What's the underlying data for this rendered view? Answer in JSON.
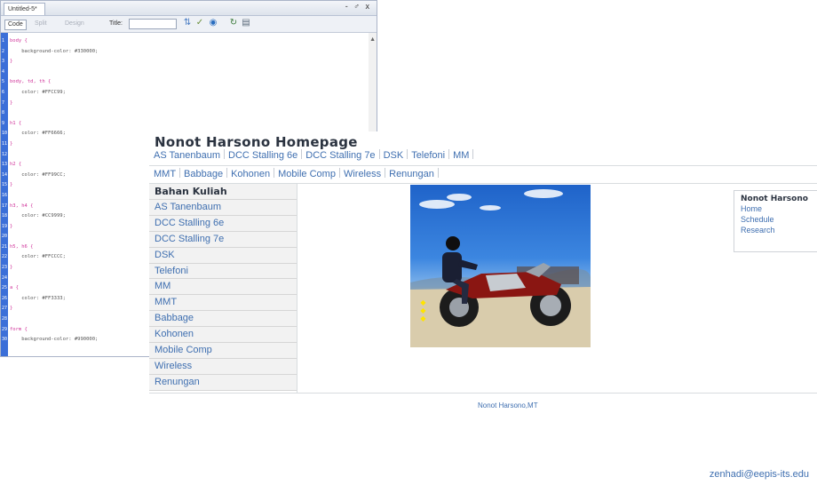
{
  "editor": {
    "tab_title": "Untitled-5*",
    "window_buttons": "- ♂ x",
    "toolbar": {
      "code_label": "Code",
      "split_label": "Split",
      "design_label": "Design",
      "title_label": "Title:"
    },
    "code_lines": [
      {
        "n": "1",
        "text": "body {",
        "cls": "sel"
      },
      {
        "n": "2",
        "text": "    background-color: #330000;",
        "cls": "prop"
      },
      {
        "n": "3",
        "text": "}",
        "cls": "brace"
      },
      {
        "n": "4",
        "text": "",
        "cls": "prop"
      },
      {
        "n": "5",
        "text": "body, td, th {",
        "cls": "sel"
      },
      {
        "n": "6",
        "text": "    color: #FFCC99;",
        "cls": "prop"
      },
      {
        "n": "7",
        "text": "}",
        "cls": "brace"
      },
      {
        "n": "8",
        "text": "",
        "cls": "prop"
      },
      {
        "n": "9",
        "text": "h1 {",
        "cls": "sel"
      },
      {
        "n": "10",
        "text": "    color: #FF6666;",
        "cls": "prop"
      },
      {
        "n": "11",
        "text": "}",
        "cls": "brace"
      },
      {
        "n": "12",
        "text": "",
        "cls": "prop"
      },
      {
        "n": "13",
        "text": "h2 {",
        "cls": "sel"
      },
      {
        "n": "14",
        "text": "    color: #FF99CC;",
        "cls": "prop"
      },
      {
        "n": "15",
        "text": "}",
        "cls": "brace"
      },
      {
        "n": "16",
        "text": "",
        "cls": "prop"
      },
      {
        "n": "17",
        "text": "h3, h4 {",
        "cls": "sel"
      },
      {
        "n": "18",
        "text": "    color: #CC9999;",
        "cls": "prop"
      },
      {
        "n": "19",
        "text": "}",
        "cls": "brace"
      },
      {
        "n": "20",
        "text": "",
        "cls": "prop"
      },
      {
        "n": "21",
        "text": "h5, h6 {",
        "cls": "sel"
      },
      {
        "n": "22",
        "text": "    color: #FFCCCC;",
        "cls": "prop"
      },
      {
        "n": "23",
        "text": "}",
        "cls": "brace"
      },
      {
        "n": "24",
        "text": "",
        "cls": "prop"
      },
      {
        "n": "25",
        "text": "a {",
        "cls": "sel"
      },
      {
        "n": "26",
        "text": "    color: #FF3333;",
        "cls": "prop"
      },
      {
        "n": "27",
        "text": "}",
        "cls": "brace"
      },
      {
        "n": "28",
        "text": "",
        "cls": "prop"
      },
      {
        "n": "29",
        "text": "form {",
        "cls": "sel"
      },
      {
        "n": "30",
        "text": "    background-color: #990000;",
        "cls": "prop"
      }
    ]
  },
  "site": {
    "title": "Nonot Harsono Homepage",
    "nav_row1": [
      "AS Tanenbaum",
      "DCC Stalling 6e",
      "DCC Stalling 7e",
      "DSK",
      "Telefoni",
      "MM"
    ],
    "nav_row2": [
      "MMT",
      "Babbage",
      "Kohonen",
      "Mobile Comp",
      "Wireless",
      "Renungan"
    ],
    "sidebar_heading": "Bahan Kuliah",
    "sidebar_items": [
      "AS Tanenbaum",
      "DCC Stalling 6e",
      "DCC Stalling 7e",
      "DSK",
      "Telefoni",
      "MM",
      "MMT",
      "Babbage",
      "Kohonen",
      "Mobile Comp",
      "Wireless",
      "Renungan"
    ],
    "right_box": {
      "name": "Nonot Harsono",
      "links": [
        "Home",
        "Schedule",
        "Research"
      ]
    },
    "footer": "Nonot Harsono,MT"
  },
  "email": "zenhadi@eepis-its.edu",
  "colors": {
    "link": "#3f6fb0",
    "gutter": "#3b6fd8",
    "selector": "#d0349a"
  }
}
